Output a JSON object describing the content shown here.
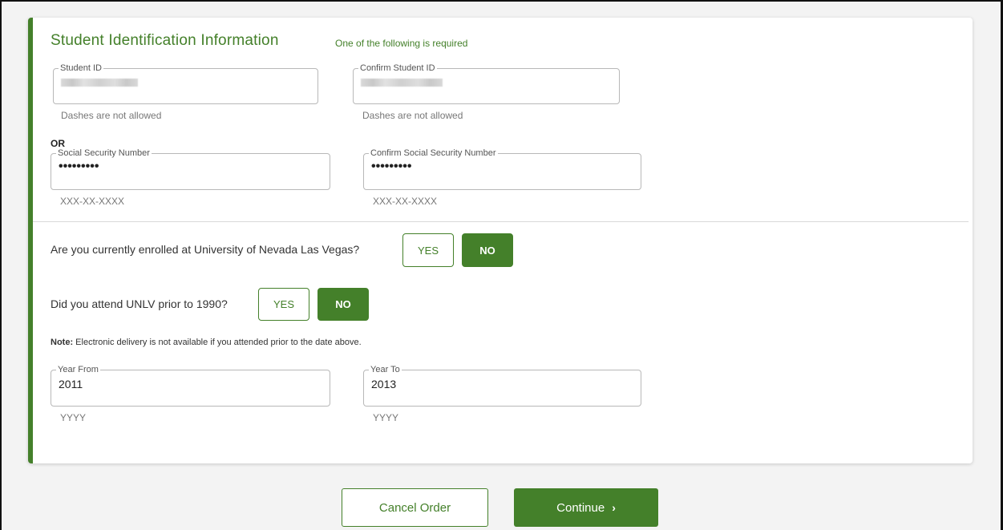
{
  "section": {
    "title": "Student Identification Information",
    "subtitle": "One of the following is required"
  },
  "student_id": {
    "label": "Student ID",
    "hint": "Dashes are not allowed"
  },
  "confirm_student_id": {
    "label": "Confirm Student ID",
    "hint": "Dashes are not allowed"
  },
  "or_label": "OR",
  "ssn": {
    "label": "Social Security Number",
    "value": "•••••••••",
    "hint": "XXX-XX-XXXX"
  },
  "confirm_ssn": {
    "label": "Confirm Social Security Number",
    "value": "•••••••••",
    "hint": "XXX-XX-XXXX"
  },
  "enrolled_question": {
    "text": "Are you currently enrolled at University of Nevada Las Vegas?",
    "yes_label": "YES",
    "no_label": "NO",
    "selected": "NO"
  },
  "prior_question": {
    "text": "Did you attend UNLV prior to 1990?",
    "yes_label": "YES",
    "no_label": "NO",
    "selected": "NO"
  },
  "note": {
    "prefix": "Note:",
    "text": " Electronic delivery is not available if you attended prior to the date above."
  },
  "year_from": {
    "label": "Year From",
    "value": "2011",
    "hint": "YYYY"
  },
  "year_to": {
    "label": "Year To",
    "value": "2013",
    "hint": "YYYY"
  },
  "actions": {
    "cancel_label": "Cancel Order",
    "continue_label": "Continue"
  },
  "colors": {
    "accent": "#44802a",
    "border": "#b8b8b8"
  }
}
